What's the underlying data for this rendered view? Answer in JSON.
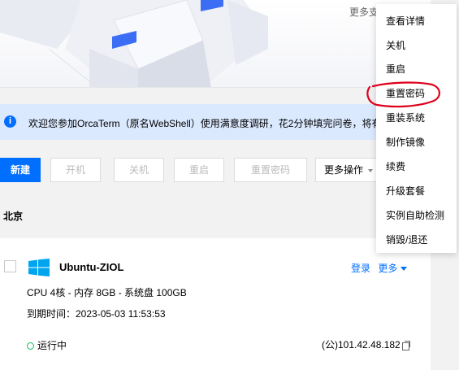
{
  "hero": {
    "more_text": "更多支"
  },
  "notice": {
    "icon": "info-icon",
    "icon_glyph": "i",
    "text": "欢迎您参加OrcaTerm（原名WebShell）使用满意度调研，花2分钟填完问卷，将有"
  },
  "toolbar": {
    "new_label": "新建",
    "start_label": "开机",
    "shutdown_label": "关机",
    "restart_label": "重启",
    "reset_password_label": "重置密码",
    "more_label": "更多操作"
  },
  "region": {
    "label": "北京"
  },
  "instance": {
    "name": "Ubuntu-ZIOL",
    "login_label": "登录",
    "more_label": "更多",
    "spec": "CPU 4核 - 内存 8GB - 系统盘 100GB",
    "expire": "到期时间：2023-05-03 11:53:53",
    "status": "运行中",
    "ip": "(公)101.42.48.182"
  },
  "menu": {
    "items": [
      {
        "label": "查看详情"
      },
      {
        "label": "关机"
      },
      {
        "label": "重启"
      },
      {
        "label": "重置密码"
      },
      {
        "label": "重装系统"
      },
      {
        "label": "制作镜像"
      },
      {
        "label": "续费"
      },
      {
        "label": "升级套餐"
      },
      {
        "label": "实例自助检测"
      },
      {
        "label": "销毁/退还"
      }
    ]
  },
  "colors": {
    "primary": "#006eff",
    "notice_bg": "#dbe9ff",
    "status_green": "#0abf5b",
    "annotation_red": "#e0001b"
  }
}
